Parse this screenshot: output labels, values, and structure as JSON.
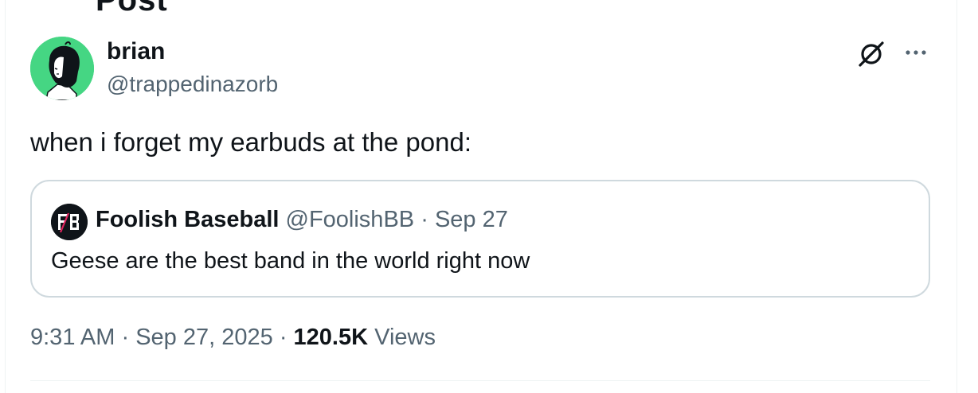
{
  "header": {
    "title": "Post"
  },
  "tweet": {
    "author_name": "brian",
    "author_handle": "@trappedinazorb",
    "text": "when i forget my earbuds at the pond:",
    "time": "9:31 AM",
    "separator": "·",
    "date": "Sep 27, 2025",
    "views_count": "120.5K",
    "views_label": "Views"
  },
  "quote": {
    "author_name": "Foolish Baseball",
    "author_handle": "@FoolishBB",
    "separator": "·",
    "date": "Sep 27",
    "text": "Geese are the best band in the world right now"
  },
  "icons": {
    "grok": "grok-icon",
    "more": "more-icon"
  },
  "colors": {
    "avatar_bg": "#45d683",
    "secondary_text": "#536471",
    "primary_text": "#0f1419",
    "border": "#cfd9de"
  }
}
